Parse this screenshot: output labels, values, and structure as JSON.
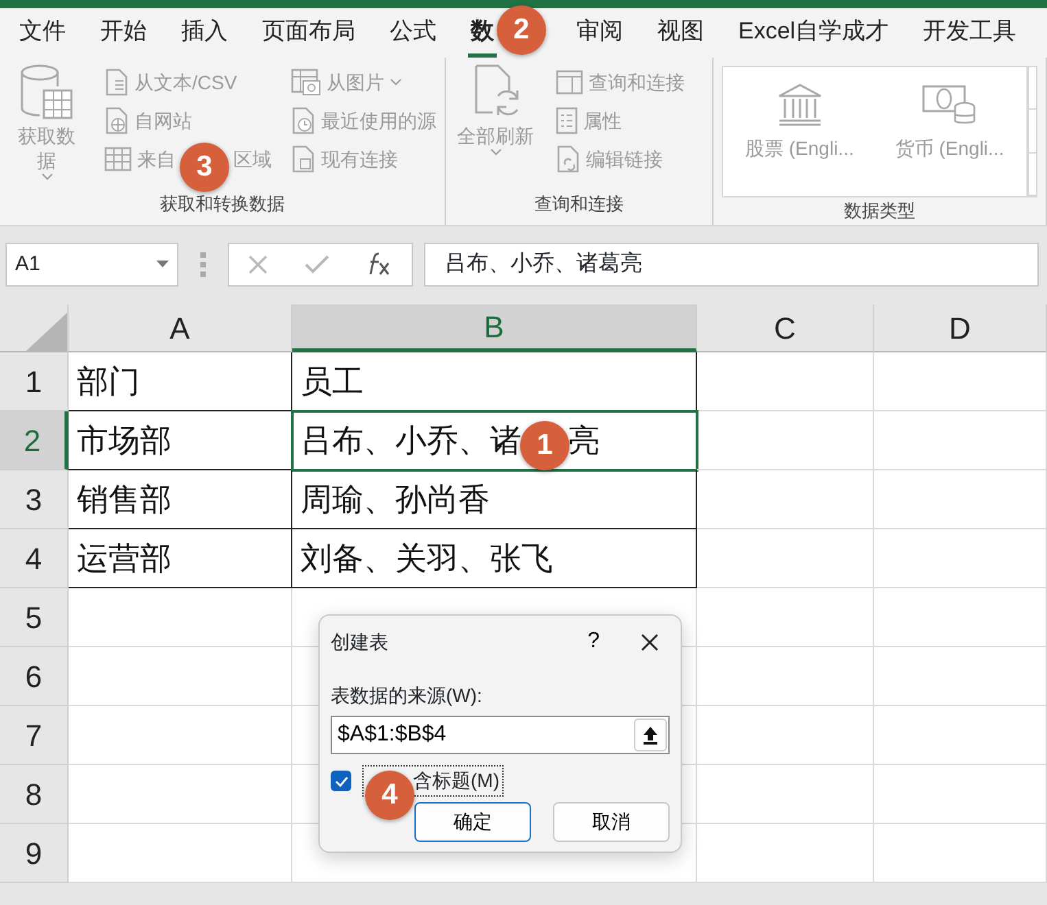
{
  "ribbon_tabs": [
    {
      "label": [
        "文件"
      ],
      "selected": false
    },
    {
      "label": [
        "开始"
      ],
      "selected": false
    },
    {
      "label": [
        "插入"
      ],
      "selected": false
    },
    {
      "label": [
        "页面布局"
      ],
      "selected": false
    },
    {
      "label": [
        "公式"
      ],
      "selected": false
    },
    {
      "label": [
        "数"
      ],
      "selected": true
    },
    {
      "label": [
        "审阅"
      ],
      "selected": false
    },
    {
      "label": [
        "视图"
      ],
      "selected": false
    },
    {
      "label": [
        "Excel自学成才"
      ],
      "selected": false
    },
    {
      "label": [
        "开发工具"
      ],
      "selected": false
    }
  ],
  "ribbon_groups": [
    {
      "label": "获取和转换数据",
      "big_button": {
        "label": "获取数据",
        "dropdown": true
      },
      "columns": [
        [
          {
            "label": [
              "从文本/CSV"
            ],
            "dropdown": false
          },
          {
            "label": [
              "自网站"
            ],
            "dropdown": false
          },
          {
            "label": [
              "来自",
              "区域"
            ],
            "dropdown": false
          }
        ],
        [
          {
            "label": [
              "从图片"
            ],
            "dropdown": true
          },
          {
            "label": [
              "最近使用的源"
            ],
            "dropdown": false
          },
          {
            "label": [
              "现有连接"
            ],
            "dropdown": false
          }
        ]
      ]
    },
    {
      "label": "查询和连接",
      "big_button": {
        "label": "全部刷新",
        "dropdown": true
      },
      "columns": [
        [
          {
            "label": [
              "查询和连接"
            ],
            "dropdown": false
          },
          {
            "label": [
              "属性"
            ],
            "dropdown": false
          },
          {
            "label": [
              "编辑链接"
            ],
            "dropdown": false
          }
        ]
      ]
    },
    {
      "label": "数据类型",
      "gallery": [
        {
          "label": "股票 (Engli..."
        },
        {
          "label": "货币 (Engli..."
        }
      ]
    }
  ],
  "name_box": "A1",
  "formula": "吕布、小乔、诸葛亮",
  "columns": [
    {
      "label": "A",
      "selected": false
    },
    {
      "label": "B",
      "selected": true
    },
    {
      "label": "C",
      "selected": false
    },
    {
      "label": "D",
      "selected": false
    }
  ],
  "rows": [
    {
      "label": "1",
      "selected": false,
      "cells": [
        [
          "部门"
        ],
        [
          "员工"
        ],
        [],
        []
      ]
    },
    {
      "label": "2",
      "selected": true,
      "cells": [
        [
          "市场部"
        ],
        [
          "吕布、小乔、诸",
          "亮"
        ],
        [],
        []
      ]
    },
    {
      "label": "3",
      "selected": false,
      "cells": [
        [
          "销售部"
        ],
        [
          "周瑜、孙尚香"
        ],
        [],
        []
      ]
    },
    {
      "label": "4",
      "selected": false,
      "cells": [
        [
          "运营部"
        ],
        [
          "刘备、关羽、张飞"
        ],
        [],
        []
      ]
    },
    {
      "label": "5",
      "selected": false,
      "cells": [
        [],
        [],
        [],
        []
      ]
    },
    {
      "label": "6",
      "selected": false,
      "cells": [
        [],
        [],
        [],
        []
      ]
    },
    {
      "label": "7",
      "selected": false,
      "cells": [
        [],
        [],
        [],
        []
      ]
    },
    {
      "label": "8",
      "selected": false,
      "cells": [
        [],
        [],
        [],
        []
      ]
    },
    {
      "label": "9",
      "selected": false,
      "cells": [
        [],
        [],
        [],
        []
      ]
    }
  ],
  "dialog": {
    "title": "创建表",
    "help": "?",
    "source_label": "表数据的来源(W):",
    "source_value": "$A$1:$B$4",
    "has_headers": {
      "label": [
        "含标题(M)"
      ],
      "checked": true
    },
    "buttons": [
      {
        "label": "确定",
        "default": true
      },
      {
        "label": "取消",
        "default": false
      }
    ]
  },
  "callouts": [
    "1",
    "2",
    "3",
    "4"
  ]
}
